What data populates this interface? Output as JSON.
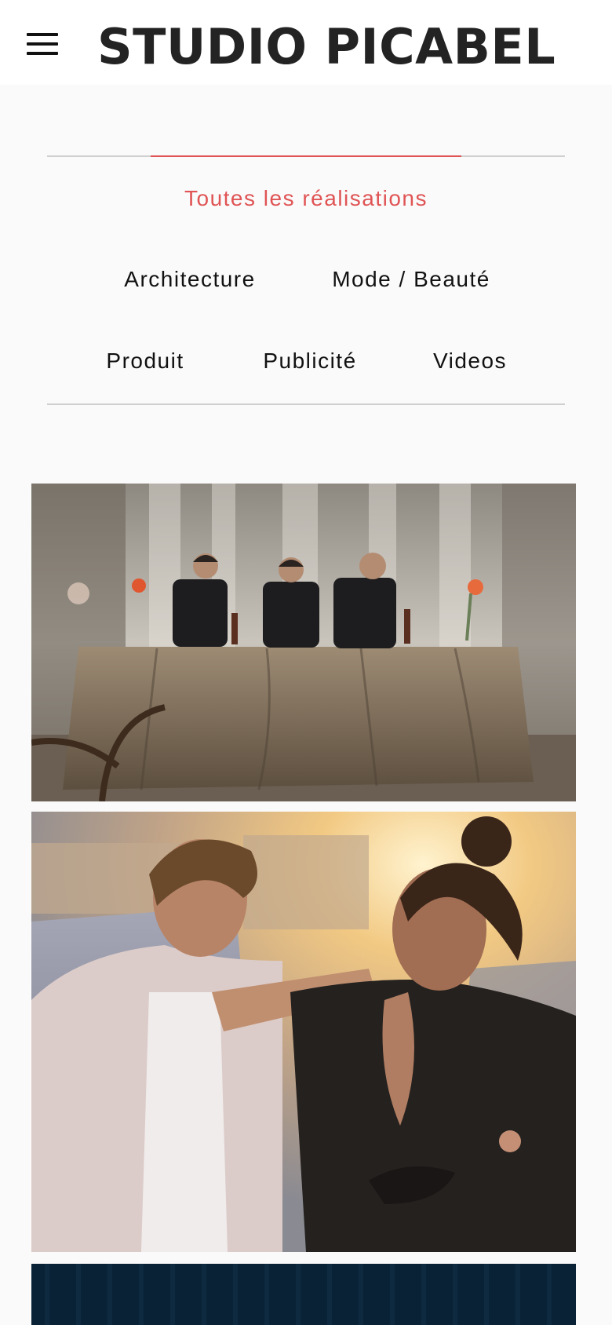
{
  "header": {
    "brand": "STUDIO PICABEL",
    "menu_icon": "hamburger-menu-icon"
  },
  "filters": {
    "all": "Toutes les réalisations",
    "architecture": "Architecture",
    "mode_beaute": "Mode / Beauté",
    "produit": "Produit",
    "publicite": "Publicité",
    "videos": "Videos"
  },
  "colors": {
    "accent": "#e05455",
    "background": "#fafafa",
    "header": "#ffffff",
    "rule": "#cfcfcf"
  },
  "gallery": [
    {
      "subject": "three chefs preparing drinks at a draped table in a studio"
    },
    {
      "subject": "couple sitting on a rooftop at sunset"
    },
    {
      "subject": "dark blue curtain backdrop"
    }
  ]
}
